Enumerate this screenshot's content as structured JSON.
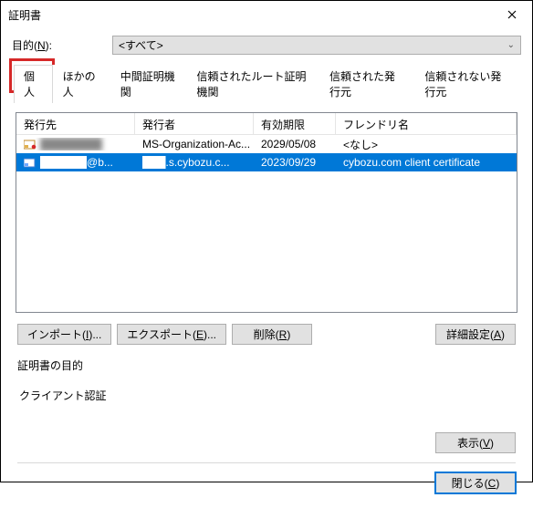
{
  "window": {
    "title": "証明書"
  },
  "purpose": {
    "label_pre": "目的(",
    "label_accel": "N",
    "label_post": "):",
    "selected": "<すべて>"
  },
  "tabs": [
    "個人",
    "ほかの人",
    "中間証明機関",
    "信頼されたルート証明機関",
    "信頼された発行元",
    "信頼されない発行元"
  ],
  "columns": {
    "issued_to": "発行先",
    "issued_by": "発行者",
    "expires": "有効期限",
    "friendly": "フレンドリ名"
  },
  "rows": [
    {
      "issued_to": "████████",
      "issued_by": "MS-Organization-Ac...",
      "expires": "2029/05/08",
      "friendly": "<なし>"
    },
    {
      "issued_to": "██████@b...",
      "issued_by": "███.s.cybozu.c...",
      "expires": "2023/09/29",
      "friendly": "cybozu.com client certificate"
    }
  ],
  "buttons": {
    "import": {
      "pre": "インポート(",
      "accel": "I",
      "post": ")..."
    },
    "export": {
      "pre": "エクスポート(",
      "accel": "E",
      "post": ")..."
    },
    "remove": {
      "pre": "削除(",
      "accel": "R",
      "post": ")"
    },
    "advanced": {
      "pre": "詳細設定(",
      "accel": "A",
      "post": ")"
    },
    "view": {
      "pre": "表示(",
      "accel": "V",
      "post": ")"
    },
    "close": {
      "pre": "閉じる(",
      "accel": "C",
      "post": ")"
    }
  },
  "intended_purpose": {
    "label": "証明書の目的",
    "value": "クライアント認証"
  }
}
